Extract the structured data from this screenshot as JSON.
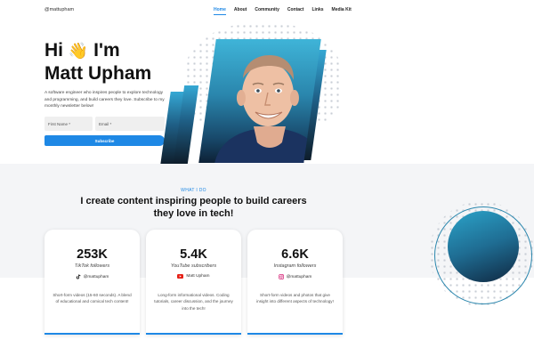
{
  "header": {
    "handle": "@mattupham",
    "nav": [
      "Home",
      "About",
      "Community",
      "Contact",
      "Links",
      "Media Kit"
    ]
  },
  "hero": {
    "greeting": "Hi",
    "wave_emoji": "👋",
    "im": "I'm",
    "name": "Matt Upham",
    "description": "A software engineer who inspires people to explore technology and programming, and build careers they love. Subscribe to my monthly newsletter below!",
    "first_name_placeholder": "First Name *",
    "email_placeholder": "Email *",
    "subscribe_label": "Subscribe"
  },
  "section": {
    "label": "WHAT I DO",
    "title": "I create content inspiring people to build careers they love in tech!"
  },
  "cards": [
    {
      "count": "253K",
      "metric": "TikTok followers",
      "handle": "@mattupham",
      "icon": "tiktok-icon",
      "description": "Short-form videos (15-60 seconds). A blend of educational and comical tech content!"
    },
    {
      "count": "5.4K",
      "metric": "YouTube subscribers",
      "handle": "Matt Upham",
      "icon": "youtube-icon",
      "description": "Long-form informational videos. Coding tutorials, career discussion, and the journey into the tech!"
    },
    {
      "count": "6.6K",
      "metric": "Instagram followers",
      "handle": "@mattupham",
      "icon": "instagram-icon",
      "description": "Short-form videos and photos that give insight into different aspects of technology!"
    }
  ],
  "colors": {
    "accent": "#1e88e5",
    "teal_light": "#3fb4d8",
    "navy": "#0d2136",
    "section_bg": "#f4f5f7"
  }
}
